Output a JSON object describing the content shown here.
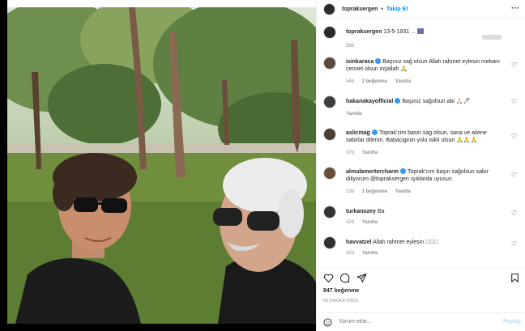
{
  "post": {
    "username": "topraksergen",
    "dot": "•",
    "follow": "Takip Et",
    "more": "···",
    "caption": {
      "username": "topraksergen",
      "text": "13-5-1931 ...",
      "age": "58d"
    },
    "likes": "847 beğenme",
    "timestamp": "58 DAKİKA ÖNCE",
    "add_comment": {
      "placeholder": "Yorum ekle...",
      "post_label": "Paylaş"
    }
  },
  "comments": [
    {
      "username": "isinkaraca",
      "verified": true,
      "text": "Başınız sağ olsun Allah rahmet eylesin mekanı cennet olsun inşallah 🙏",
      "age": "54d",
      "likes": "2 beğenme",
      "reply": "Yanıtla"
    },
    {
      "username": "hakanakayofficial",
      "verified": true,
      "text": "Başınız sağolsun abi 🙏🏻🖊",
      "age": "",
      "likes": "",
      "reply": "Yanıtla"
    },
    {
      "username": "aslicmag",
      "verified": true,
      "text": "Toprak'cim basin sag olsun, sana ve ailene sabirlar dilerim. Babaciginin yolu isikli olsun 🙏🙏🙏",
      "age": "37d",
      "likes": "",
      "reply": "Yanıtla"
    },
    {
      "username": "almulamertercharm",
      "verified": true,
      "text": "Toprak'cım başın sağolsun sabır diliyorum @topraksergen ışıklarda uyusun",
      "age": "23d",
      "likes": "1 beğenme",
      "reply": "Yanıtla"
    },
    {
      "username": "turkanozey",
      "verified": false,
      "text": "Ba",
      "age": "42d",
      "likes": "",
      "reply": "Yanıtla"
    },
    {
      "username": "havvatzel",
      "verified": false,
      "text": "Allah rahmet eylesin ❋🏻🏻",
      "age": "42d",
      "likes": "",
      "reply": "Yanıtla"
    }
  ],
  "icons": [
    "heart-icon",
    "comment-icon",
    "share-icon",
    "bookmark-icon",
    "smile-icon",
    "more-icon"
  ],
  "colors": {
    "follow": "#0095f6",
    "verified": "#3897f0",
    "meta": "#8e8e8e",
    "post_disabled": "#b2dffc"
  }
}
